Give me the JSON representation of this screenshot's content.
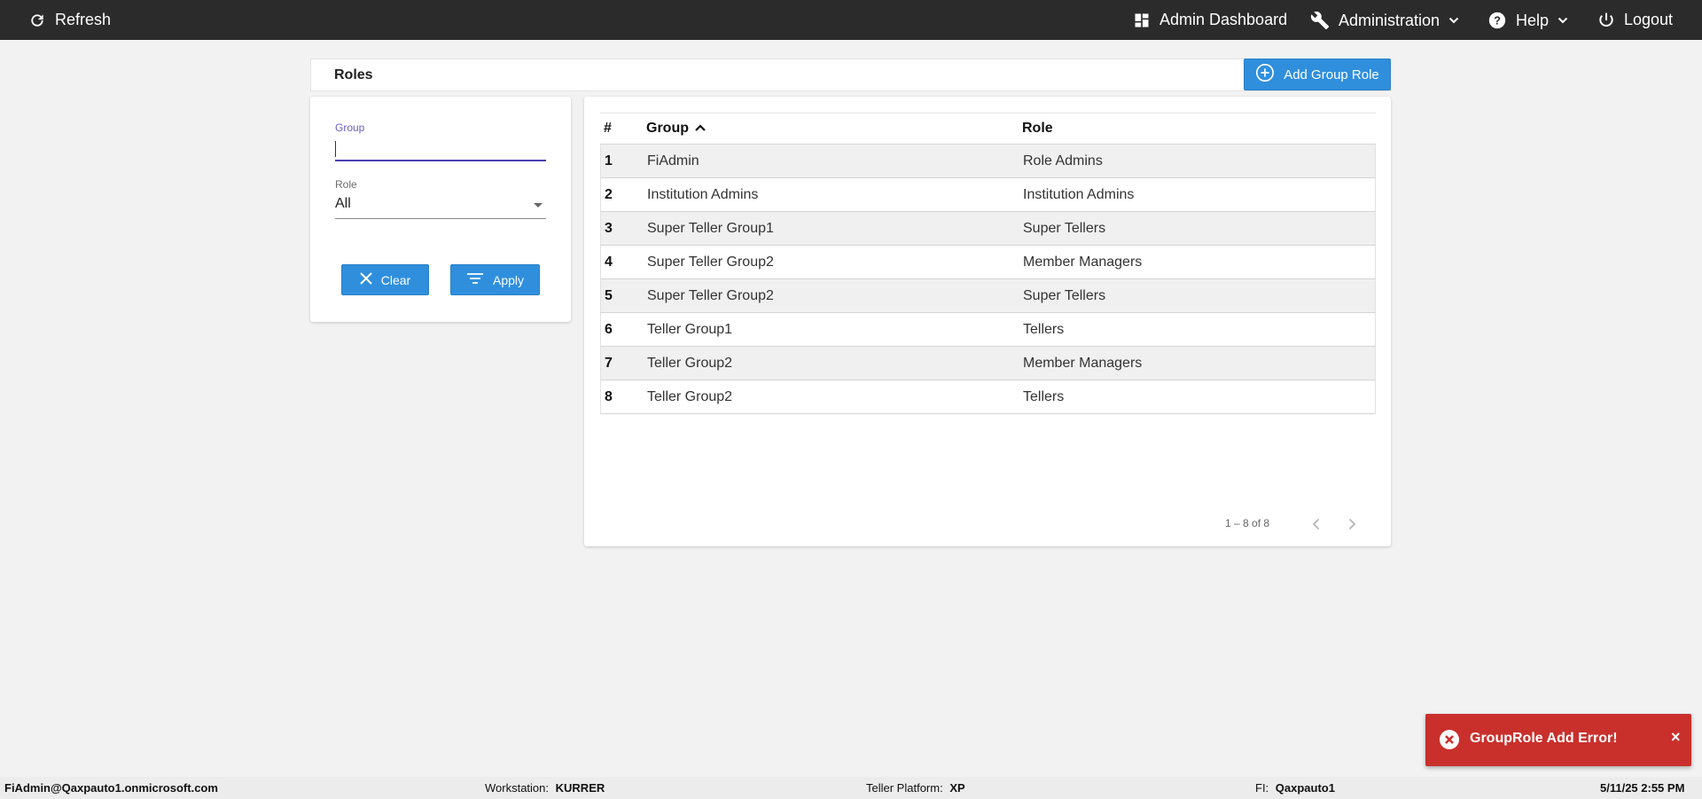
{
  "topbar": {
    "refresh_label": "Refresh",
    "admin_dashboard_label": "Admin Dashboard",
    "administration_label": "Administration",
    "help_label": "Help",
    "logout_label": "Logout"
  },
  "page": {
    "title": "Roles",
    "add_button_label": "Add Group Role"
  },
  "filters": {
    "group_label": "Group",
    "group_value": "",
    "role_label": "Role",
    "role_value": "All",
    "clear_label": "Clear",
    "apply_label": "Apply"
  },
  "table": {
    "headers": {
      "num": "#",
      "group": "Group",
      "role": "Role"
    },
    "rows": [
      {
        "num": "1",
        "group": "FiAdmin",
        "role": "Role Admins"
      },
      {
        "num": "2",
        "group": "Institution Admins",
        "role": "Institution Admins"
      },
      {
        "num": "3",
        "group": "Super Teller Group1",
        "role": "Super Tellers"
      },
      {
        "num": "4",
        "group": "Super Teller Group2",
        "role": "Member Managers"
      },
      {
        "num": "5",
        "group": "Super Teller Group2",
        "role": "Super Tellers"
      },
      {
        "num": "6",
        "group": "Teller Group1",
        "role": "Tellers"
      },
      {
        "num": "7",
        "group": "Teller Group2",
        "role": "Member Managers"
      },
      {
        "num": "8",
        "group": "Teller Group2",
        "role": "Tellers"
      }
    ],
    "pagination": "1 – 8 of 8"
  },
  "toast": {
    "message": "GroupRole Add Error!",
    "close": "×"
  },
  "statusbar": {
    "user": "FiAdmin@Qaxpauto1.onmicrosoft.com",
    "workstation_label": "Workstation:",
    "workstation_value": "KURRER",
    "platform_label": "Teller Platform:",
    "platform_value": "XP",
    "fi_label": "FI:",
    "fi_value": "Qaxpauto1",
    "datetime": "5/11/25 2:55 PM"
  },
  "colors": {
    "topbar": "#2b2b2b",
    "accent_blue": "#2f8fdd",
    "error_red": "#c9302c",
    "focus_underline": "#4a3fb0"
  }
}
